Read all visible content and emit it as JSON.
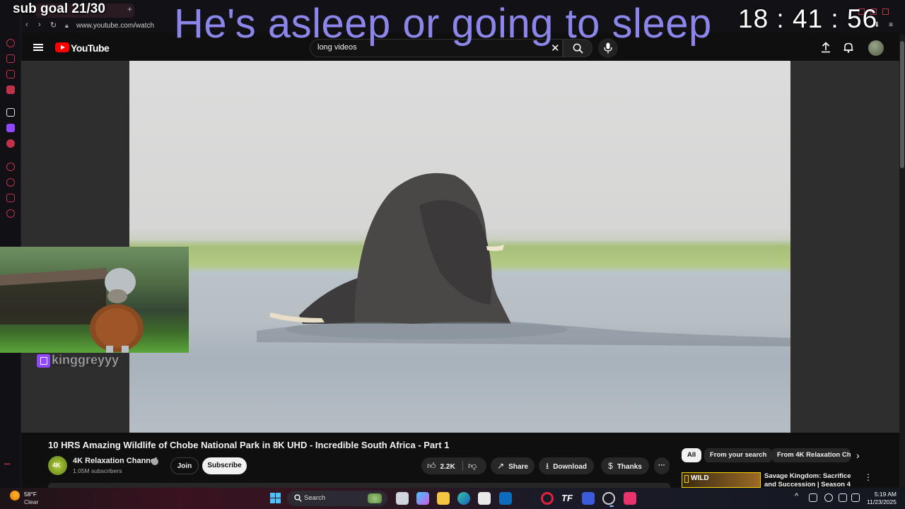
{
  "overlay": {
    "sub_goal": "sub goal 21/30",
    "status": "He's asleep or going to sleep",
    "clock": "18 : 41 : 56",
    "channel_tag": "kinggreyyy"
  },
  "browser": {
    "url": "www.youtube.com/watch",
    "accent": "#c0324a"
  },
  "youtube": {
    "logo_text": "YouTube",
    "search_value": "long videos",
    "search_placeholder": "Search",
    "brand_red": "#ff0000"
  },
  "video": {
    "title": "10 HRS Amazing Wildlife of Chobe National Park in 8K UHD - Incredible South Africa - Part 1",
    "channel_name": "4K Relaxation Channel",
    "channel_avatar_text": "4K",
    "subscribers": "1.05M subscribers",
    "join_label": "Join",
    "subscribe_label": "Subscribe",
    "like_count": "2.2K",
    "share_label": "Share",
    "download_label": "Download",
    "thanks_label": "Thanks"
  },
  "related": {
    "chips": [
      "All",
      "From your search",
      "From 4K Relaxation Channel"
    ],
    "items": [
      {
        "thumb_label": "WILD",
        "title": "Savage Kingdom: Sacrifice and Succession | Season 4 MEGA"
      }
    ]
  },
  "taskbar": {
    "weather_temp": "58°F",
    "weather_cond": "Clear",
    "search_label": "Search",
    "time": "5:19 AM",
    "date": "11/23/2025"
  }
}
